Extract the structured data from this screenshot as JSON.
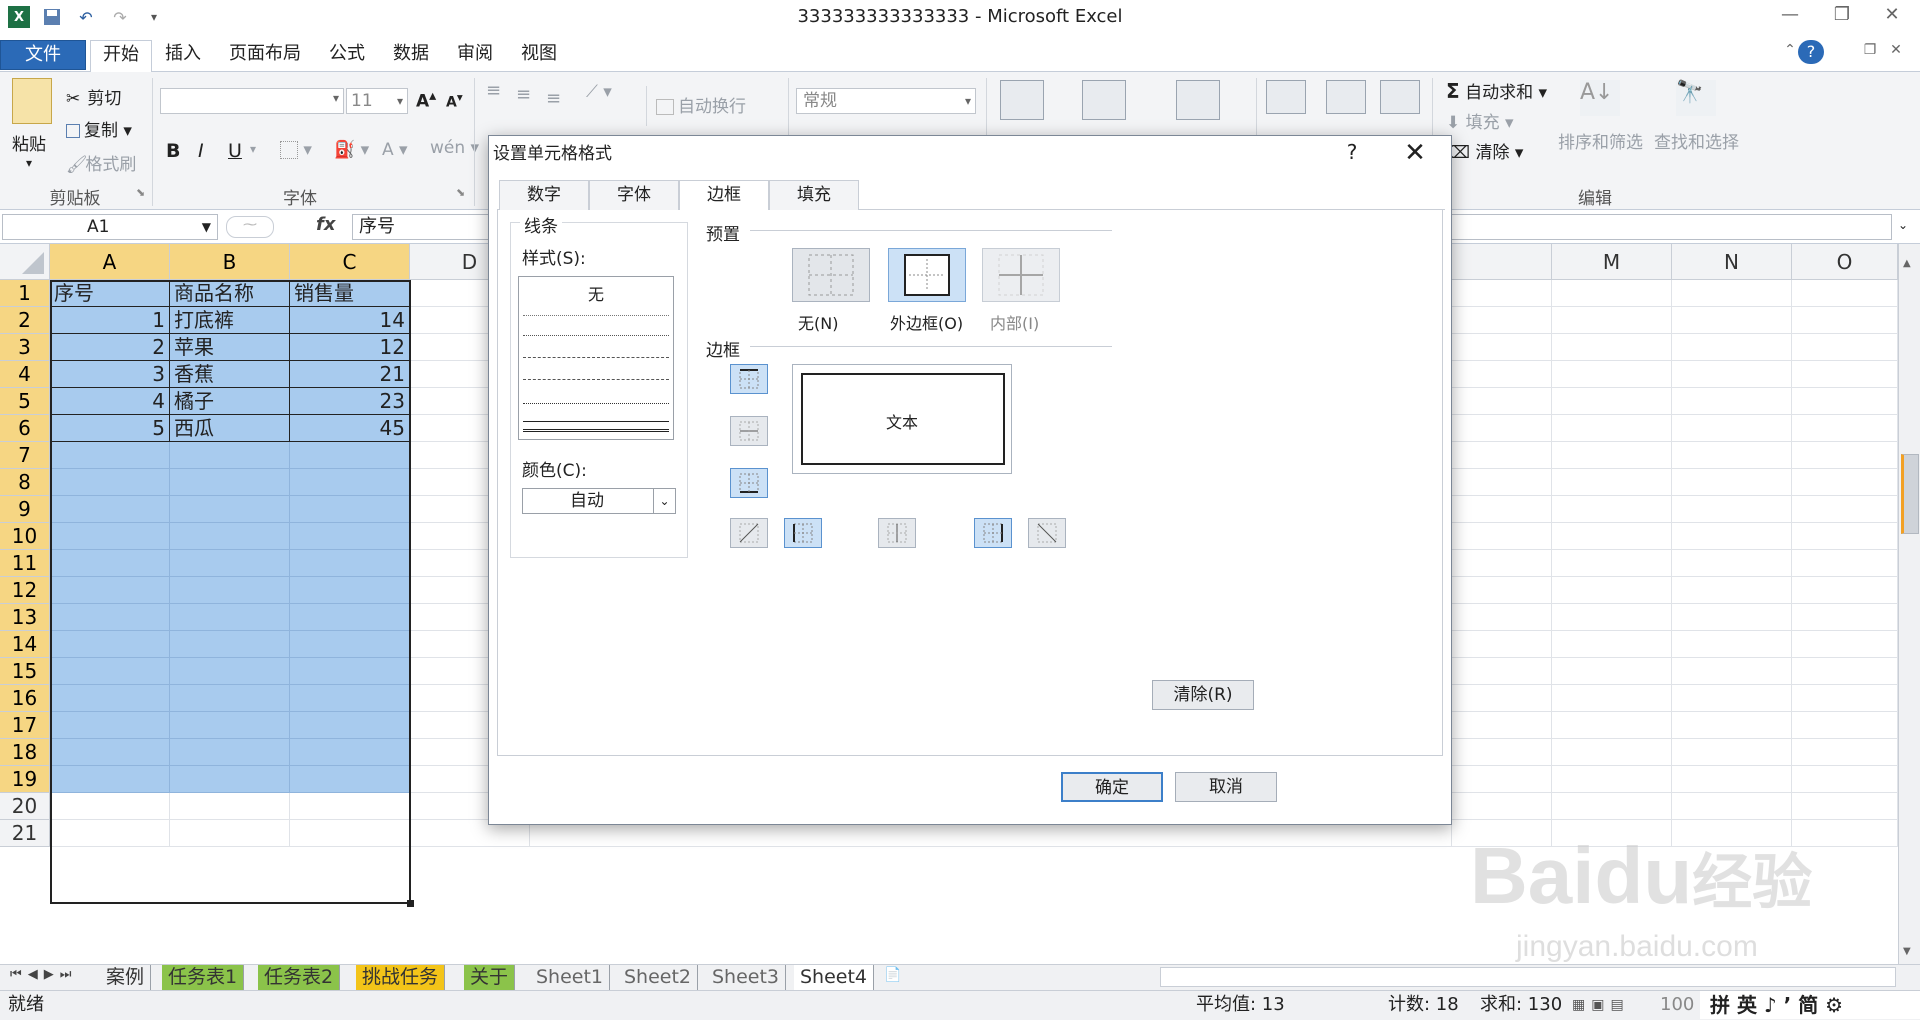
{
  "window": {
    "title": "333333333333333 - Microsoft Excel"
  },
  "menu": {
    "file": "文件",
    "tabs": [
      "开始",
      "插入",
      "页面布局",
      "公式",
      "数据",
      "审阅",
      "视图"
    ]
  },
  "ribbon": {
    "clipboard": {
      "paste": "粘贴",
      "cut": "剪切",
      "copy": "复制",
      "format_painter": "格式刷",
      "group": "剪贴板"
    },
    "font": {
      "size": "11",
      "group": "字体",
      "bold": "B",
      "italic": "I",
      "underline": "U"
    },
    "align": {
      "wrap": "自动换行"
    },
    "number": {
      "format": "常规"
    },
    "editing": {
      "autosum": "自动求和",
      "fill": "填充",
      "clear": "清除",
      "sort": "排序和筛选",
      "find": "查找和选择",
      "group": "编辑"
    }
  },
  "formula_bar": {
    "name_box": "A1",
    "fx": "fx",
    "value": "序号"
  },
  "sheet": {
    "columns": [
      "A",
      "B",
      "C",
      "D",
      "M",
      "N",
      "O"
    ],
    "rows": [
      "1",
      "2",
      "3",
      "4",
      "5",
      "6",
      "7",
      "8",
      "9",
      "10",
      "11",
      "12",
      "13",
      "14",
      "15",
      "16",
      "17",
      "18",
      "19",
      "20",
      "21"
    ],
    "data": [
      [
        "序号",
        "商品名称",
        "销售量"
      ],
      [
        "1",
        "打底裤",
        "14"
      ],
      [
        "2",
        "苹果",
        "12"
      ],
      [
        "3",
        "香蕉",
        "21"
      ],
      [
        "4",
        "橘子",
        "23"
      ],
      [
        "5",
        "西瓜",
        "45"
      ]
    ]
  },
  "sheet_tabs": [
    "案例",
    "任务表1",
    "任务表2",
    "挑战任务",
    "关于",
    "Sheet1",
    "Sheet2",
    "Sheet3",
    "Sheet4"
  ],
  "status": {
    "ready": "就绪",
    "average": "平均值: 13",
    "count": "计数: 18",
    "sum": "求和: 130",
    "zoom": "100"
  },
  "dialog": {
    "title": "设置单元格格式",
    "help": "?",
    "tabs": [
      "数字",
      "字体",
      "边框",
      "填充"
    ],
    "line_section": "线条",
    "style_label": "样式(S):",
    "style_none": "无",
    "color_label": "颜色(C):",
    "color_value": "自动",
    "preset_section": "预置",
    "preset_none": "无(N)",
    "preset_outline": "外边框(O)",
    "preset_inside": "内部(I)",
    "border_section": "边框",
    "preview_text": "文本",
    "clear_button": "清除(R)",
    "ok_button": "确定",
    "cancel_button": "取消"
  },
  "watermark": {
    "brand": "Bai",
    "paw": "du",
    "cn": "经验",
    "url": "jingyan.baidu.com"
  }
}
